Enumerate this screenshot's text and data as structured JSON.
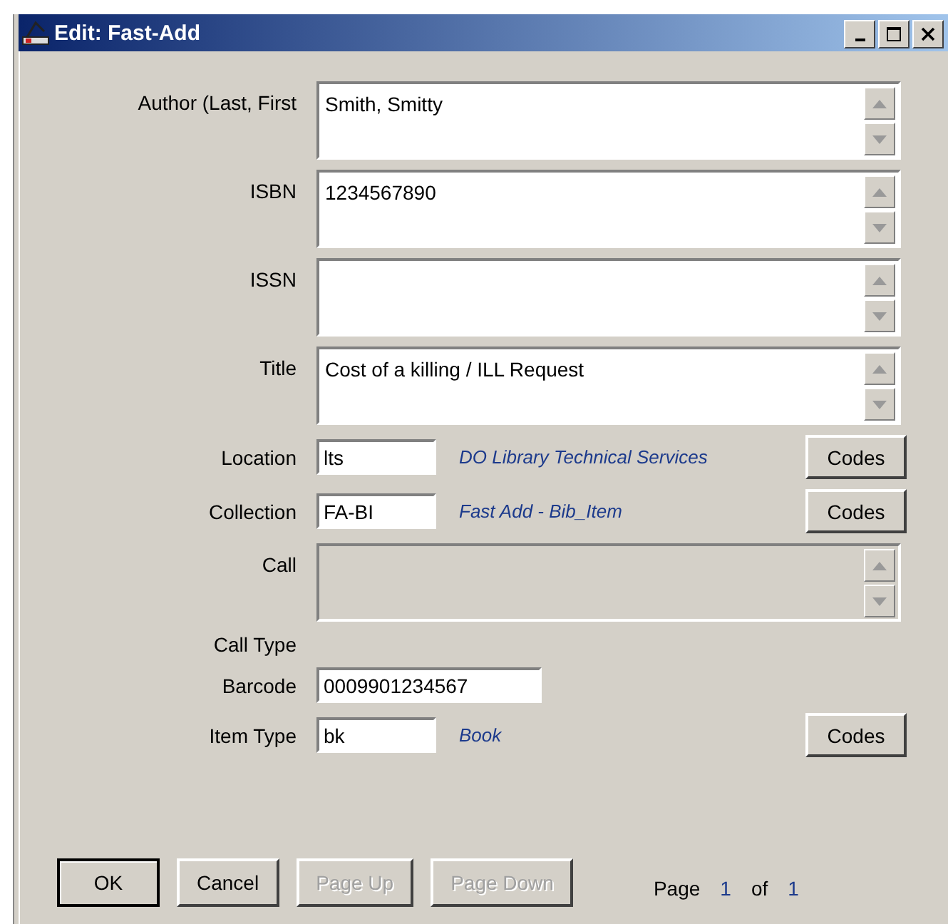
{
  "window": {
    "title": "Edit: Fast-Add"
  },
  "fields": [
    {
      "kind": "memo",
      "label": "Author (Last, First",
      "value": "Smith, Smitty",
      "disabled": false
    },
    {
      "kind": "memo",
      "label": "ISBN",
      "value": "1234567890",
      "disabled": false
    },
    {
      "kind": "memo",
      "label": "ISSN",
      "disabled": false
    },
    {
      "kind": "memo",
      "label": "Title",
      "value": "Cost of a killing / ILL Request",
      "disabled": false
    },
    {
      "kind": "code",
      "label": "Location",
      "value": "lts",
      "description": "DO Library Technical Services",
      "button": "Codes"
    },
    {
      "kind": "code",
      "label": "Collection",
      "value": "FA-BI",
      "description": "Fast Add - Bib_Item",
      "button": "Codes"
    },
    {
      "kind": "memo",
      "label": "Call",
      "disabled": true
    },
    {
      "kind": "label",
      "label": "Call Type"
    },
    {
      "kind": "plain",
      "label": "Barcode",
      "value": "0009901234567"
    },
    {
      "kind": "code",
      "label": "Item Type",
      "value": "bk",
      "description": "Book",
      "button": "Codes"
    }
  ],
  "buttons": [
    {
      "label": "OK",
      "disabled": false,
      "default": true
    },
    {
      "label": "Cancel",
      "disabled": false,
      "default": false
    },
    {
      "label": "Page Up",
      "disabled": true,
      "default": false
    },
    {
      "label": "Page Down",
      "disabled": true,
      "default": false
    }
  ],
  "pager": {
    "label": "Page",
    "current": "1",
    "separator": "of",
    "total": "1"
  }
}
